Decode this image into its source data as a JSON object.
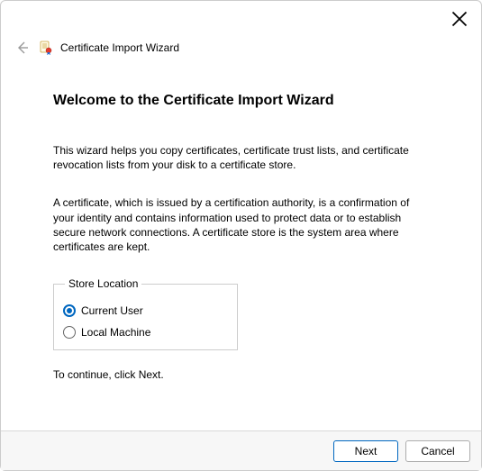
{
  "header": {
    "title": "Certificate Import Wizard"
  },
  "main": {
    "title": "Welcome to the Certificate Import Wizard",
    "para1": "This wizard helps you copy certificates, certificate trust lists, and certificate revocation lists from your disk to a certificate store.",
    "para2": "A certificate, which is issued by a certification authority, is a confirmation of your identity and contains information used to protect data or to establish secure network connections. A certificate store is the system area where certificates are kept.",
    "store_legend": "Store Location",
    "option_current_user": "Current User",
    "option_local_machine": "Local Machine",
    "option_selected": "current_user",
    "continue_text": "To continue, click Next."
  },
  "footer": {
    "next": "Next",
    "cancel": "Cancel"
  }
}
